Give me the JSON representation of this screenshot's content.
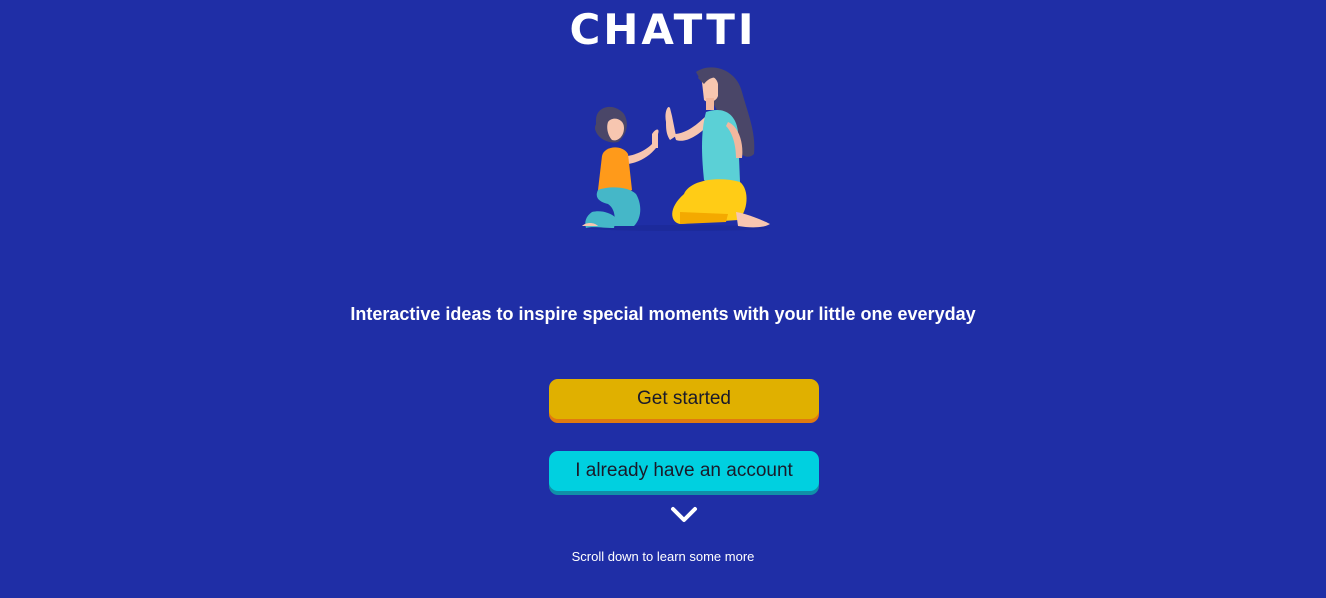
{
  "brand": {
    "logo_text": "CHATTI"
  },
  "hero": {
    "illustration_icon": "mother-child-high-five-illustration"
  },
  "tagline": "Interactive ideas to inspire special moments with your little one everyday",
  "actions": {
    "get_started_label": "Get started",
    "login_label": "I already have an account"
  },
  "scroll": {
    "icon": "chevron-down-icon",
    "hint": "Scroll down to learn some more"
  },
  "colors": {
    "background": "#1f2ea6",
    "primary_button": "#e0b000",
    "primary_button_shadow": "#e07a10",
    "secondary_button": "#00d0e0",
    "secondary_button_shadow": "#1090a8",
    "text": "#ffffff"
  }
}
